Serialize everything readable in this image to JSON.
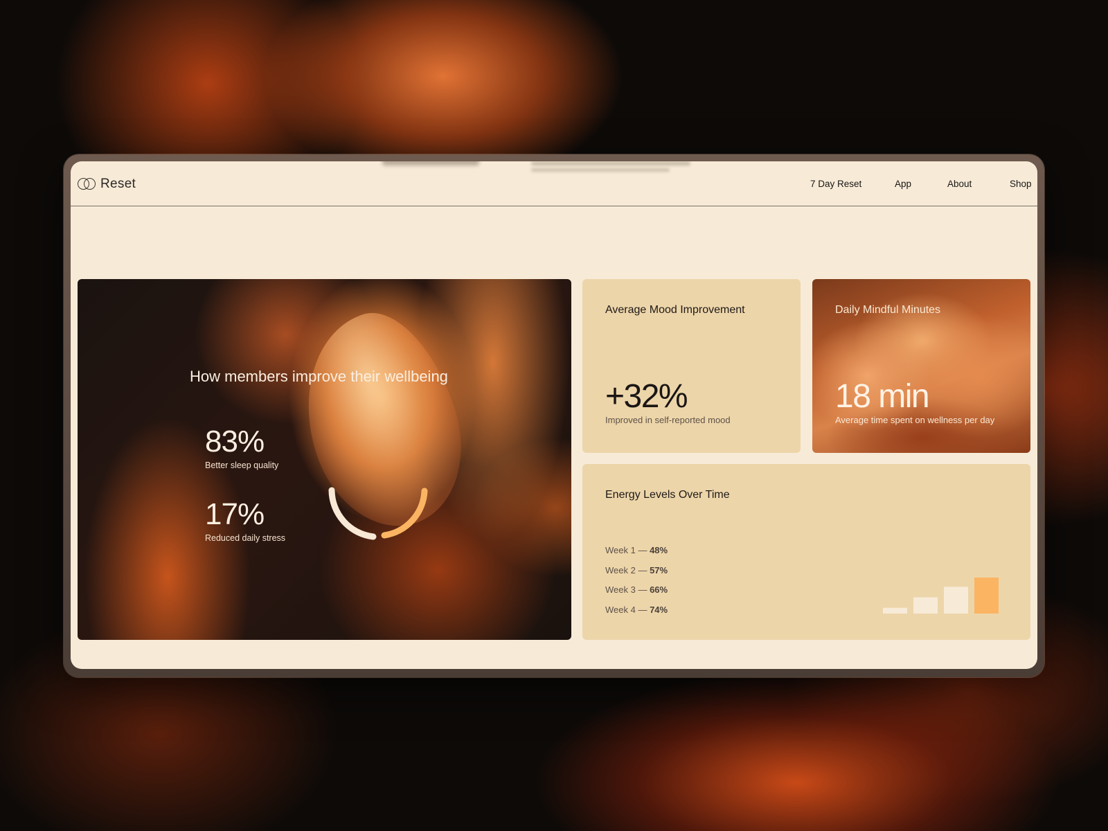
{
  "brand": {
    "name": "Reset"
  },
  "nav": [
    "7 Day Reset",
    "App",
    "About",
    "Shop"
  ],
  "hero": {
    "title": "How members improve their wellbeing",
    "stats": [
      {
        "value": "83%",
        "label": "Better sleep quality"
      },
      {
        "value": "17%",
        "label": "Reduced daily stress"
      }
    ]
  },
  "mood": {
    "title": "Average Mood Improvement",
    "value": "+32%",
    "caption": "Improved in self-reported mood"
  },
  "mindful": {
    "title": "Daily Mindful Minutes",
    "value": "18 min",
    "caption": "Average time spent on wellness per day"
  },
  "energy": {
    "title": "Energy Levels Over Time",
    "weeks": [
      {
        "label": "Week 1 —",
        "value": "48%",
        "pct": 48
      },
      {
        "label": "Week 2 —",
        "value": "57%",
        "pct": 57
      },
      {
        "label": "Week 3 —",
        "value": "66%",
        "pct": 66
      },
      {
        "label": "Week 4 —",
        "value": "74%",
        "pct": 74
      }
    ],
    "bar_colors": [
      "#f7ebd8",
      "#f7ebd8",
      "#f7ebd8",
      "#fbb462"
    ]
  },
  "colors": {
    "accent": "#fbb462",
    "cream": "#f7ebd8",
    "card": "#edd5aa"
  }
}
